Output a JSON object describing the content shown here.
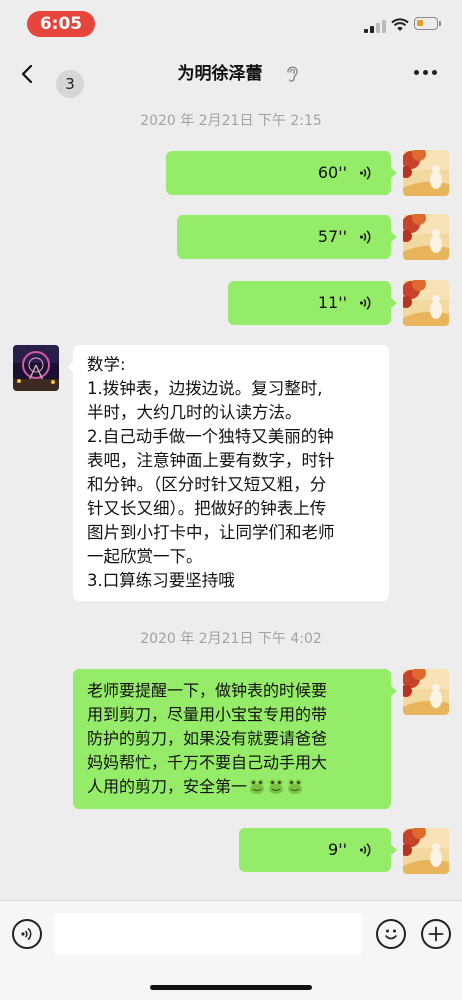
{
  "status_bar": {
    "time": "6:05"
  },
  "nav": {
    "back_count": "3",
    "title": "为明徐泽蕾"
  },
  "timestamps": [
    "2020 年 2月21日  下午 2:15",
    "2020 年 2月21日  下午 4:02"
  ],
  "voice_messages": [
    {
      "duration": "60''"
    },
    {
      "duration": "57''"
    },
    {
      "duration": "11''"
    },
    {
      "duration": "9''"
    }
  ],
  "incoming_message": {
    "lines": [
      "数学:",
      "1.拨钟表，边拨边说。复习整时,",
      "半时，大约几时的认读方法。",
      "2.自己动手做一个独特又美丽的钟",
      "表吧，注意钟面上要有数字，时针",
      "和分钟。（区分时针又短又粗，分",
      "针又长又细）。把做好的钟表上传",
      "图片到小打卡中，让同学们和老师",
      "一起欣赏一下。",
      "3.口算练习要坚持哦"
    ]
  },
  "outgoing_message": {
    "lines": [
      "老师要提醒一下，做钟表的时候要",
      "用到剪刀，尽量用小宝宝专用的带",
      "防护的剪刀，如果没有就要请爸爸",
      "妈妈帮忙，千万不要自己动手用大",
      "人用的剪刀，安全第一"
    ],
    "emoji_count": 3
  },
  "input": {
    "value": ""
  },
  "colors": {
    "bubble_green": "#95ec69",
    "background": "#ededed",
    "time_pill": "#e5453a"
  }
}
